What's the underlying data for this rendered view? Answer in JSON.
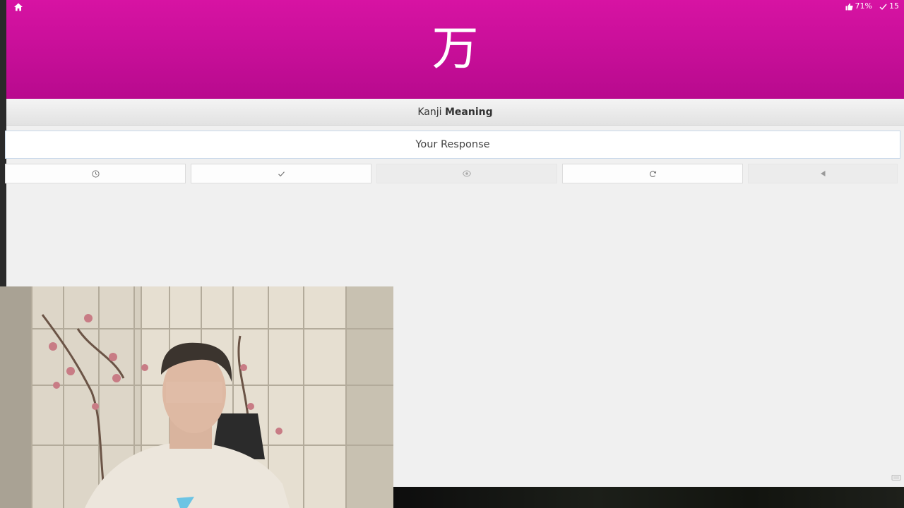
{
  "header": {
    "kanji": "万",
    "stats": [
      {
        "icon": "thumbs-up-icon",
        "value": "71%"
      },
      {
        "icon": "check-icon",
        "value": "15"
      }
    ],
    "accent_color": "#d01299"
  },
  "question": {
    "subject": "Kanji",
    "type": "Meaning"
  },
  "answer": {
    "placeholder": "Your Response"
  },
  "action_buttons": [
    {
      "name": "clock-icon"
    },
    {
      "name": "check-icon"
    },
    {
      "name": "eye-icon"
    },
    {
      "name": "undo-icon"
    },
    {
      "name": "back-arrow-icon"
    }
  ]
}
